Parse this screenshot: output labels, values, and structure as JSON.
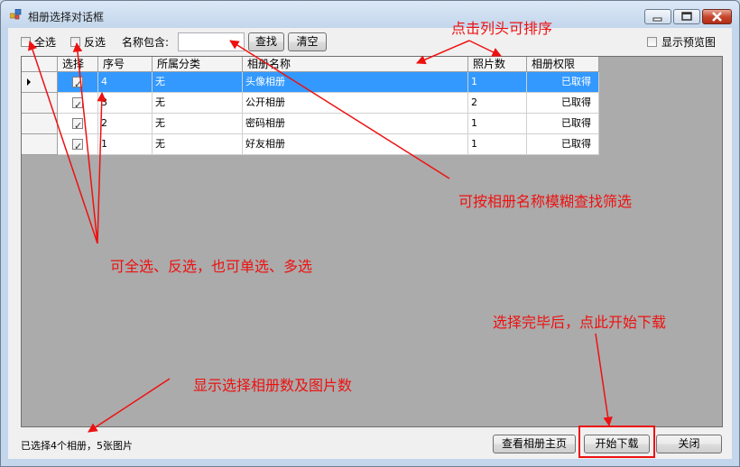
{
  "window": {
    "title": "相册选择对话框"
  },
  "toolbar": {
    "select_all_label": "全选",
    "invert_label": "反选",
    "name_filter_label": "名称包含:",
    "name_filter_value": "",
    "search_label": "查找",
    "clear_label": "清空",
    "preview_label": "显示预览图"
  },
  "grid": {
    "columns": [
      "选择",
      "序号",
      "所属分类",
      "相册名称",
      "照片数",
      "相册权限"
    ],
    "rows": [
      {
        "checked": true,
        "index": "4",
        "category": "无",
        "name": "头像相册",
        "photos": "1",
        "permission": "已取得",
        "selected": true
      },
      {
        "checked": true,
        "index": "3",
        "category": "无",
        "name": "公开相册",
        "photos": "2",
        "permission": "已取得",
        "selected": false
      },
      {
        "checked": true,
        "index": "2",
        "category": "无",
        "name": "密码相册",
        "photos": "1",
        "permission": "已取得",
        "selected": false
      },
      {
        "checked": true,
        "index": "1",
        "category": "无",
        "name": "好友相册",
        "photos": "1",
        "permission": "已取得",
        "selected": false
      }
    ]
  },
  "status": {
    "text": "已选择4个相册，5张图片"
  },
  "buttons": {
    "view_home_label": "查看相册主页",
    "start_download_label": "开始下载",
    "close_label": "关闭"
  },
  "annotations": {
    "sort_hint": "点击列头可排序",
    "filter_hint": "可按相册名称模糊查找筛选",
    "select_hint": "可全选、反选，也可单选、多选",
    "download_hint": "选择完毕后，点此开始下载",
    "count_hint": "显示选择相册数及图片数"
  },
  "colors": {
    "annotation": "#ee1111",
    "selection": "#3399ff"
  }
}
